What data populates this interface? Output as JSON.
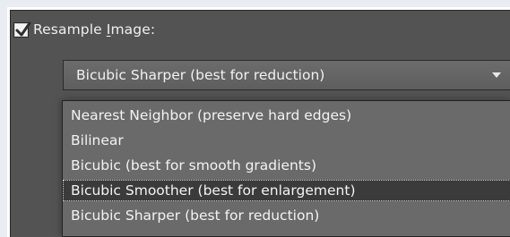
{
  "resample": {
    "checked": true,
    "label_prefix": "Resample ",
    "label_mnemonic": "I",
    "label_suffix": "mage:"
  },
  "dropdown": {
    "selected_value": "Bicubic Sharper (best for reduction)",
    "options": [
      {
        "label": "Nearest Neighbor (preserve hard edges)",
        "highlighted": false
      },
      {
        "label": "Bilinear",
        "highlighted": false
      },
      {
        "label": "Bicubic (best for smooth gradients)",
        "highlighted": false
      },
      {
        "label": "Bicubic Smoother (best for enlargement)",
        "highlighted": true
      },
      {
        "label": "Bicubic Sharper (best for reduction)",
        "highlighted": false
      }
    ]
  }
}
